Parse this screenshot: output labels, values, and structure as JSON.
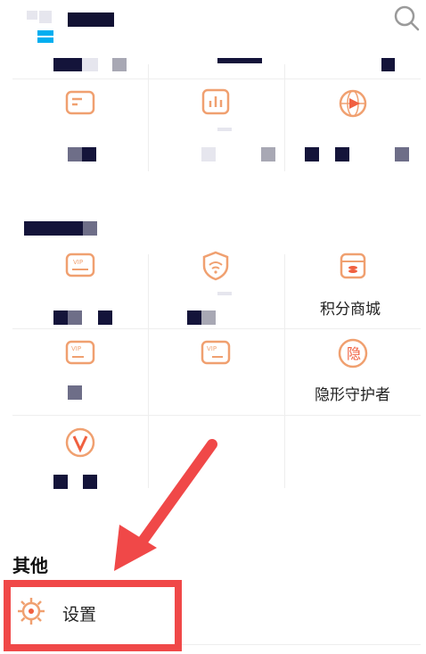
{
  "header": {
    "icons": [
      "search-icon"
    ]
  },
  "section_other": {
    "title": "其他"
  },
  "grid": {
    "points_mall_label": "积分商城",
    "invisible_guardian_label": "隐形守护者"
  },
  "settings": {
    "label": "设置",
    "icon": "gear-icon"
  },
  "colors": {
    "accent_orange": "#f0a070",
    "highlight_red": "#f04848",
    "search_gray": "#9a9a9a"
  }
}
